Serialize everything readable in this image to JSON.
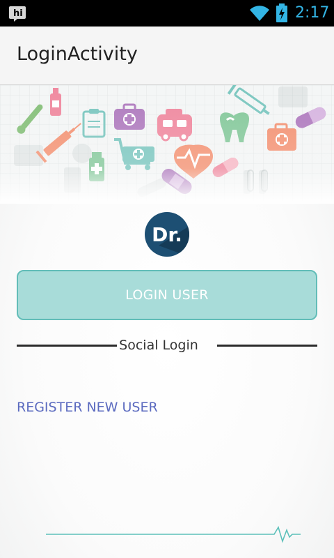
{
  "status_bar": {
    "time": "2:17",
    "icons": [
      "hi-app-icon",
      "wifi-icon",
      "battery-icon"
    ],
    "accent": "#33b5e5"
  },
  "action_bar": {
    "title": "LoginActivity"
  },
  "logo": {
    "text": "Dr.",
    "color": "#1d4f73"
  },
  "login": {
    "button_label": "LOGIN USER",
    "button_color": "#a8dcd9",
    "border_color": "#62bdb8"
  },
  "social": {
    "label": "Social Login"
  },
  "register": {
    "link_label": "REGISTER NEW USER",
    "color": "#3f51b5"
  },
  "banner_icons": [
    "thermometer-icon",
    "bottle-icon",
    "syringe-icon",
    "clipboard-icon",
    "first-aid-kit-icon",
    "ambulance-icon",
    "tooth-icon",
    "pill-capsule-icon",
    "medicine-bottle-icon",
    "shopping-cart-icon",
    "heartbeat-icon",
    "bandage-icon",
    "test-tubes-icon"
  ]
}
